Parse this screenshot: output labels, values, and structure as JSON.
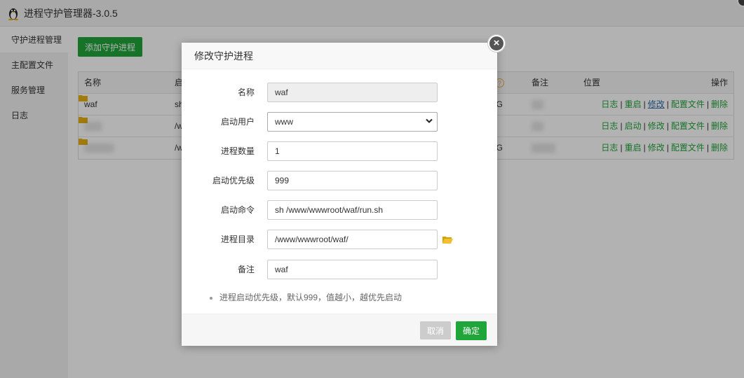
{
  "app": {
    "title": "进程守护管理器-3.0.5"
  },
  "sidebar": {
    "items": [
      {
        "label": "守护进程管理"
      },
      {
        "label": "主配置文件"
      },
      {
        "label": "服务管理"
      },
      {
        "label": "日志"
      }
    ]
  },
  "toolbar": {
    "add_label": "添加守护进程"
  },
  "table": {
    "headers": {
      "name": "名称",
      "cmd": "启",
      "note": "备注",
      "position": "位置",
      "actions": "操作"
    },
    "rows": [
      {
        "name": "waf",
        "cmd": "sh",
        "status": "NING",
        "note": "",
        "actions": [
          "日志",
          "重启",
          "修改",
          "配置文件",
          "删除"
        ]
      },
      {
        "name": "",
        "cmd": "/w",
        "status": "",
        "note": "",
        "actions": [
          "日志",
          "启动",
          "修改",
          "配置文件",
          "删除"
        ]
      },
      {
        "name": "",
        "cmd": "/w",
        "status": "NING",
        "note": "",
        "actions": [
          "日志",
          "重启",
          "修改",
          "配置文件",
          "删除"
        ]
      }
    ]
  },
  "modal": {
    "title": "修改守护进程",
    "fields": {
      "name": {
        "label": "名称",
        "value": "waf"
      },
      "user": {
        "label": "启动用户",
        "value": "www"
      },
      "count": {
        "label": "进程数量",
        "value": "1"
      },
      "priority": {
        "label": "启动优先级",
        "value": "999"
      },
      "command": {
        "label": "启动命令",
        "value": "sh /www/wwwroot/waf/run.sh"
      },
      "directory": {
        "label": "进程目录",
        "value": "/www/wwwroot/waf/"
      },
      "note": {
        "label": "备注",
        "value": "waf"
      }
    },
    "hint": "进程启动优先级，默认999，值越小，越优先启动",
    "cancel_label": "取消",
    "confirm_label": "确定"
  },
  "colors": {
    "accent": "#20a53a",
    "link_edit": "#2d6ea8"
  }
}
